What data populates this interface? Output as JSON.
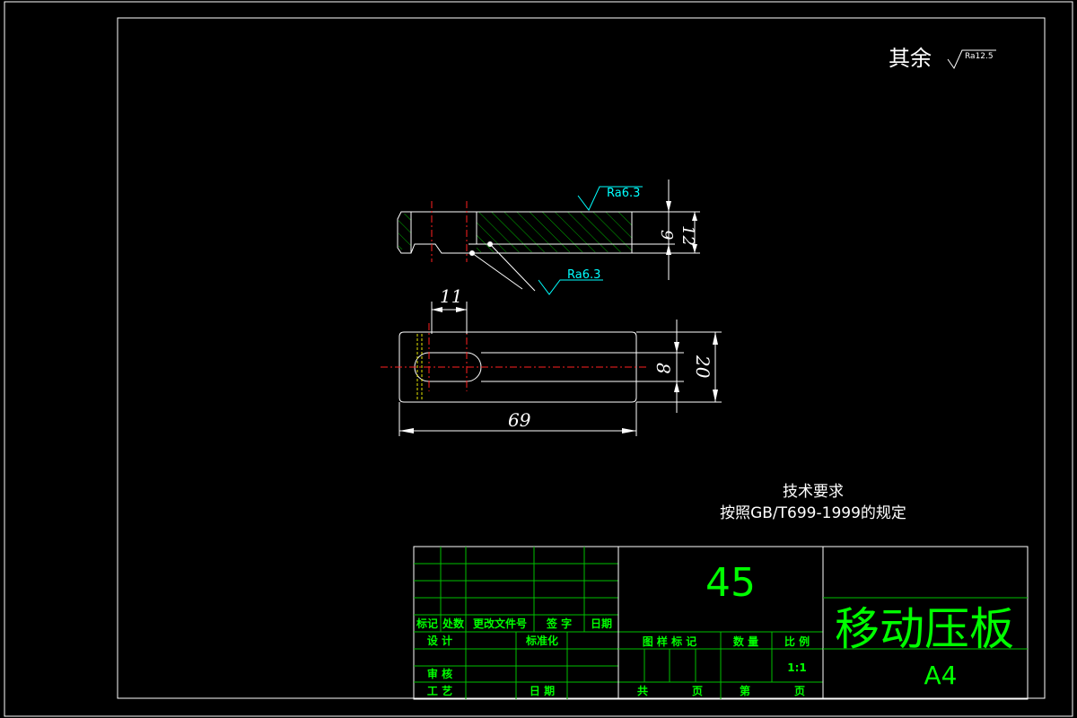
{
  "roughness": {
    "rest_label": "其余",
    "rest_value": "Ra12.5",
    "top_value": "Ra6.3",
    "bottom_value": "Ra6.3"
  },
  "dimensions": {
    "slot_offset": "11",
    "total_length": "69",
    "slot_width": "8",
    "width": "20",
    "inner_height": "9",
    "thickness": "12"
  },
  "notes": {
    "title": "技术要求",
    "line1": "按照GB/T699-1999的规定"
  },
  "title_block": {
    "material": "45",
    "part_name": "移动压板",
    "sheet_size": "A4",
    "headers": {
      "mark": "标记",
      "location": "处数",
      "change_doc": "更改文件号",
      "signature": "签 字",
      "date": "日期",
      "design": "设 计",
      "standardize": "标准化",
      "review": "审 核",
      "process": "工 艺",
      "date2": "日 期",
      "drawing_mark": "图 样 标 记",
      "quantity": "数 量",
      "scale": "比 例",
      "scale_value": "1:1",
      "total": "共",
      "page": "页",
      "sheet": "第",
      "page2": "页"
    }
  },
  "colors": {
    "background": "#000000",
    "outline": "#ffffff",
    "table": "#00c000",
    "text": "#00ff00",
    "center_line": "#ff2020",
    "roughness": "#00ffff",
    "hidden": "#e8e800"
  }
}
